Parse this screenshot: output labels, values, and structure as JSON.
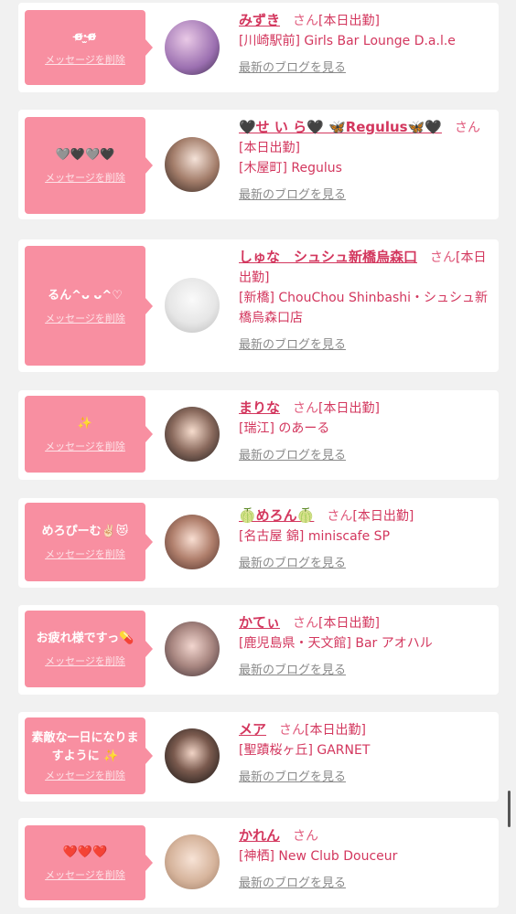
{
  "delete_label": "メッセージを削除",
  "blog_label": "最新のブログを見る",
  "cards": [
    {
      "message": "ɞ̴̶̷·̫ɞ̴̶̷",
      "name": "みずき",
      "san": "さん",
      "status": "[本日出勤]",
      "shop": "[川崎駅前] Girls Bar Lounge D.a.l.e"
    },
    {
      "message": "🩶🖤🩶🖤",
      "name": "🖤せ い ら🖤 🦋Regulus🦋🖤",
      "san": "さん",
      "status": "[本日出勤]",
      "shop": "[木屋町] Regulus"
    },
    {
      "message": "るん^ᴗ ᴗ^♡",
      "name": "しゅな　シュシュ新橋烏森口",
      "san": "さん",
      "status": "[本日出勤]",
      "shop": "[新橋] ChouChou Shinbashi・シュシュ新橋烏森口店"
    },
    {
      "message": "✨",
      "name": "まりな",
      "san": "さん",
      "status": "[本日出勤]",
      "shop": "[瑞江] のあーる"
    },
    {
      "message": "めろぴーむ✌🏻😻",
      "name": "🍈めろん🍈",
      "san": "さん",
      "status": "[本日出勤]",
      "shop": "[名古屋 錦] miniscafe SP"
    },
    {
      "message": "お疲れ様ですっ💊",
      "name": "かてぃ",
      "san": "さん",
      "status": "[本日出勤]",
      "shop": "[鹿児島県・天文館] Bar アオハル"
    },
    {
      "message": "素敵な一日になりますように ✨",
      "name": "メア",
      "san": "さん",
      "status": "[本日出勤]",
      "shop": "[聖蹟桜ヶ丘] GARNET"
    },
    {
      "message": "❤️❤️❤️",
      "name": "かれん",
      "san": "さん",
      "status": "",
      "shop": "[神栖] New Club Douceur"
    }
  ],
  "colors": {
    "bubble": "#f88fa1",
    "text": "#d3375e",
    "page_bg": "#f1f1f1"
  }
}
